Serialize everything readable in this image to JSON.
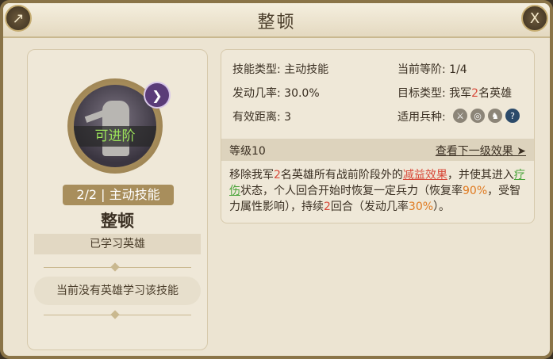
{
  "window": {
    "title": "整顿",
    "share_icon": "share-icon",
    "close_icon": "close-icon",
    "close_glyph": "X",
    "share_glyph": "↗"
  },
  "skill_card": {
    "advance_label": "可进阶",
    "chevron_icon": "chevron-down-icon",
    "level_text": "2/2",
    "separator": "|",
    "skill_type": "主动技能",
    "name": "整顿",
    "learned_label": "已学习英雄",
    "no_hero_text": "当前没有英雄学习该技能"
  },
  "stats": {
    "skill_type_label": "技能类型:",
    "skill_type_value": "主动技能",
    "trigger_rate_label": "发动几率:",
    "trigger_rate_value": "30.0%",
    "range_label": "有效距离:",
    "range_value": "3",
    "current_rank_label": "当前等阶:",
    "current_rank_value": "1/4",
    "target_label": "目标类型:",
    "target_prefix": "我军",
    "target_number": "2",
    "target_suffix": "名英雄",
    "troop_label": "适用兵种:",
    "troop_icons": [
      "sword-icon",
      "target-icon",
      "horse-icon",
      "question-icon"
    ]
  },
  "level": {
    "label": "等级10",
    "next_link": "查看下一级效果 ➤"
  },
  "description": {
    "p1": "移除我军",
    "n1": "2",
    "p2": "名英雄所有战前阶段外的",
    "debuff": "减益效果",
    "p3": "，并使其进入",
    "heal": "疗伤",
    "p4": "状态，个人回合开始时恢复一定兵力（恢复率",
    "recover_rate": "90%",
    "p5": "，受智力属性影响），持续",
    "n2": "2",
    "p6": "回合（发动几率",
    "rate": "30%",
    "p7": "）。"
  },
  "colors": {
    "accent_red": "#d84a3a",
    "accent_green": "#4aa43a",
    "accent_orange": "#e07a20",
    "advance_green": "#9be35a"
  }
}
